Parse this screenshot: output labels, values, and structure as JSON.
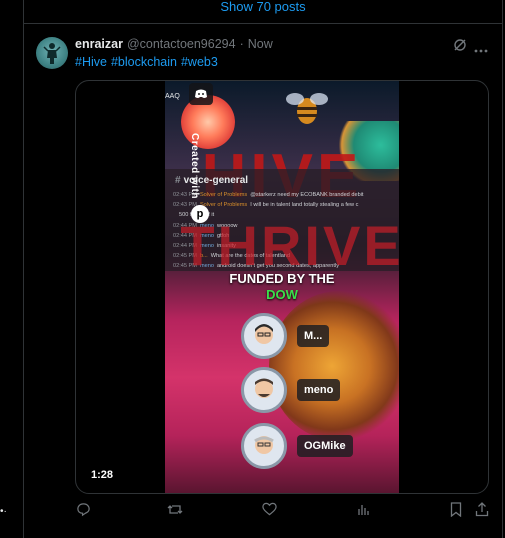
{
  "timeline": {
    "show_posts_label": "Show 70 posts"
  },
  "post": {
    "author_name": "enraizar",
    "author_handle": "@contactoen96294",
    "separator": "·",
    "time": "Now",
    "hashtags": [
      "#Hive",
      "#blockchain",
      "#web3"
    ],
    "icons": {
      "grok": "grok-icon",
      "more": "more-icon"
    },
    "video": {
      "timestamp": "1:28",
      "top_label": "AAQ",
      "created_with": "Created with",
      "created_logo": "p",
      "big_word_1": "HIVE",
      "big_word_2": "THRIVE",
      "chat": {
        "channel": "voice-general",
        "lines": [
          {
            "ts": "02:43 PM",
            "user": "Solver of Problems",
            "user_color": "orange",
            "text": "@starkerz need my ECOBANK branded debit"
          },
          {
            "ts": "02:43 PM",
            "user": "Solver of Problems",
            "user_color": "orange",
            "text": "I will be in talent land totally stealing a few c"
          },
          {
            "ts": "",
            "user": "",
            "user_color": "orange",
            "text": "500 for all of it"
          },
          {
            "ts": "02:44 PM",
            "user": "meno",
            "user_color": "blue",
            "text": "woooow"
          },
          {
            "ts": "02:44 PM",
            "user": "meno",
            "user_color": "blue",
            "text": "gtfoh"
          },
          {
            "ts": "02:44 PM",
            "user": "meno",
            "user_color": "blue",
            "text": "insanity"
          },
          {
            "ts": "02:45 PM",
            "user": "b...",
            "user_color": "orange",
            "text": "What are the dates of talentland"
          },
          {
            "ts": "02:45 PM",
            "user": "meno",
            "user_color": "blue",
            "text": "android doesn't get you second dates, apparently"
          }
        ]
      },
      "funded_line_1": "FUNDED BY THE",
      "funded_line_2": "DOW",
      "members": [
        {
          "name": "M..."
        },
        {
          "name": "meno"
        },
        {
          "name": "OGMike"
        }
      ]
    },
    "actions": {
      "reply": "reply-icon",
      "repost": "repost-icon",
      "like": "like-icon",
      "views": "views-icon",
      "bookmark": "bookmark-icon",
      "share": "share-icon"
    }
  },
  "colors": {
    "accent": "#1d9bf0",
    "muted": "#71767b",
    "border": "#2f3336",
    "background": "#000000"
  }
}
